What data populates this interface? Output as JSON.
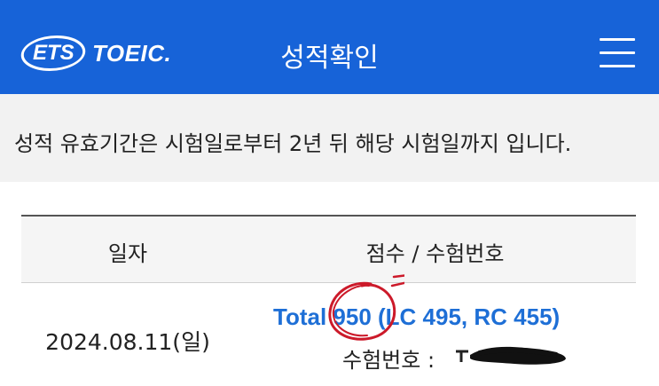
{
  "header": {
    "logo_ets": "ETS",
    "logo_toeic": "TOEIC.",
    "title": "성적확인",
    "menu_icon": "hamburger-menu-icon"
  },
  "notice": {
    "text": "성적 유효기간은 시험일로부터 2년 뒤 해당 시험일까지 입니다."
  },
  "table": {
    "columns": [
      "일자",
      "점수 / 수험번호"
    ],
    "rows": [
      {
        "date": "2024.08.11(일)",
        "score_text": "Total 950 (LC 495, RC 455)",
        "total": 950,
        "lc": 495,
        "rc": 455,
        "exam_number_label": "수험번호 :"
      }
    ]
  },
  "colors": {
    "header_bg": "#1763d8",
    "score_text": "#1e6fd6",
    "notice_bg": "#f2f2f2",
    "annotation": "#cc1a2a"
  }
}
